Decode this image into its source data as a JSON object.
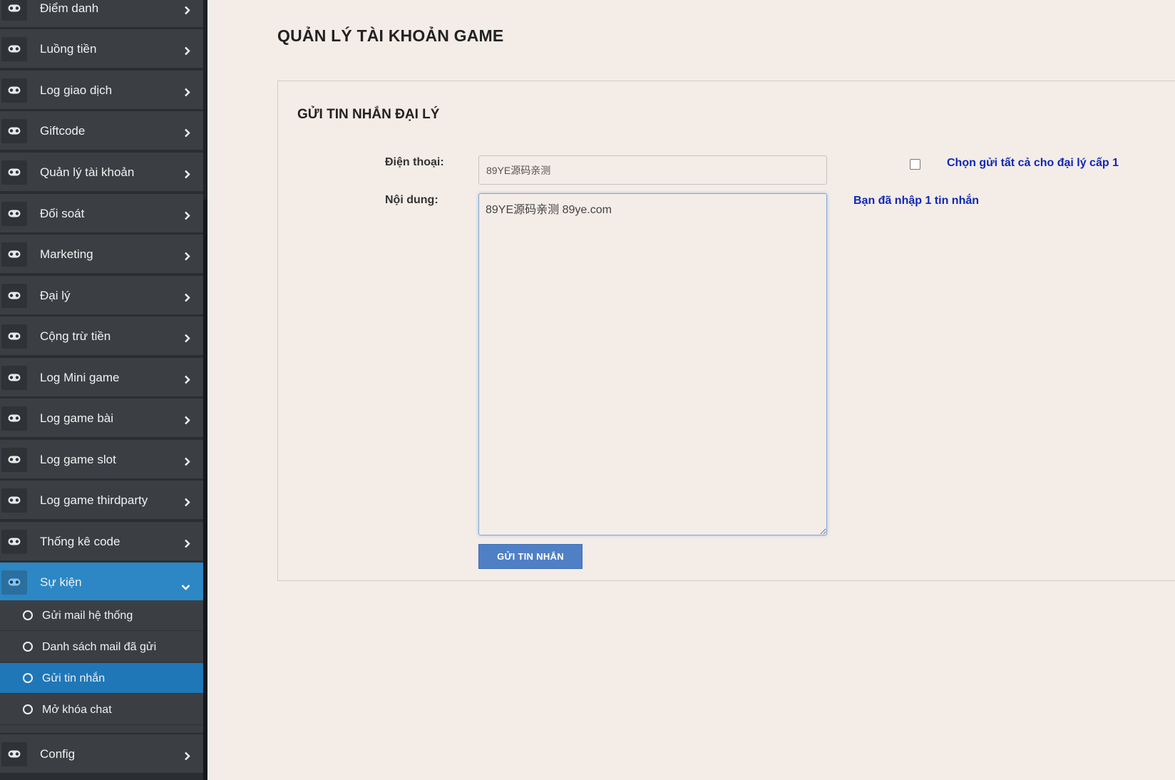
{
  "sidebar": {
    "items": [
      {
        "label": "Điểm danh",
        "icon": "gamepad-icon"
      },
      {
        "label": "Luồng tiền",
        "icon": "gamepad-icon"
      },
      {
        "label": "Log giao dịch",
        "icon": "gamepad-icon"
      },
      {
        "label": "Giftcode",
        "icon": "gamepad-icon"
      },
      {
        "label": "Quản lý tài khoản",
        "icon": "gamepad-icon"
      },
      {
        "label": "Đối soát",
        "icon": "gamepad-icon"
      },
      {
        "label": "Marketing",
        "icon": "gamepad-icon"
      },
      {
        "label": "Đại lý",
        "icon": "gamepad-icon"
      },
      {
        "label": "Cộng trừ tiền",
        "icon": "gamepad-icon"
      },
      {
        "label": "Log Mini game",
        "icon": "gamepad-icon"
      },
      {
        "label": "Log game bài",
        "icon": "gamepad-icon"
      },
      {
        "label": "Log game slot",
        "icon": "gamepad-icon"
      },
      {
        "label": "Log game thirdparty",
        "icon": "gamepad-icon"
      },
      {
        "label": "Thống kê code",
        "icon": "gamepad-icon"
      },
      {
        "label": "Sự kiện",
        "icon": "gamepad-icon",
        "active": true
      },
      {
        "label": "Config",
        "icon": "gamepad-icon"
      }
    ],
    "submenu": [
      {
        "label": "Gửi mail hệ thống"
      },
      {
        "label": "Danh sách mail đã gửi"
      },
      {
        "label": "Gửi tin nhắn",
        "active": true
      },
      {
        "label": "Mở khóa chat"
      }
    ]
  },
  "main": {
    "page_title": "QUẢN LÝ TÀI KHOẢN GAME",
    "panel_title": "GỬI TIN NHẮN ĐẠI LÝ",
    "phone_label": "Điện thoại:",
    "phone_value": "89YE源码亲测",
    "content_label": "Nội dung:",
    "content_value": "89YE源码亲测 89ye.com",
    "send_all_label": "Chọn gửi tất cả cho đại lý cấp 1",
    "send_all_checked": false,
    "message_count": "Bạn đã nhập 1 tin nhắn",
    "send_button": "GỬI TIN NHẮN"
  },
  "colors": {
    "sidebar_bg": "#3b3f44",
    "active_bg": "#2c87c4",
    "page_bg": "#f4ece7",
    "link_blue": "#0f28b5",
    "button_bg": "#4f80c6"
  }
}
